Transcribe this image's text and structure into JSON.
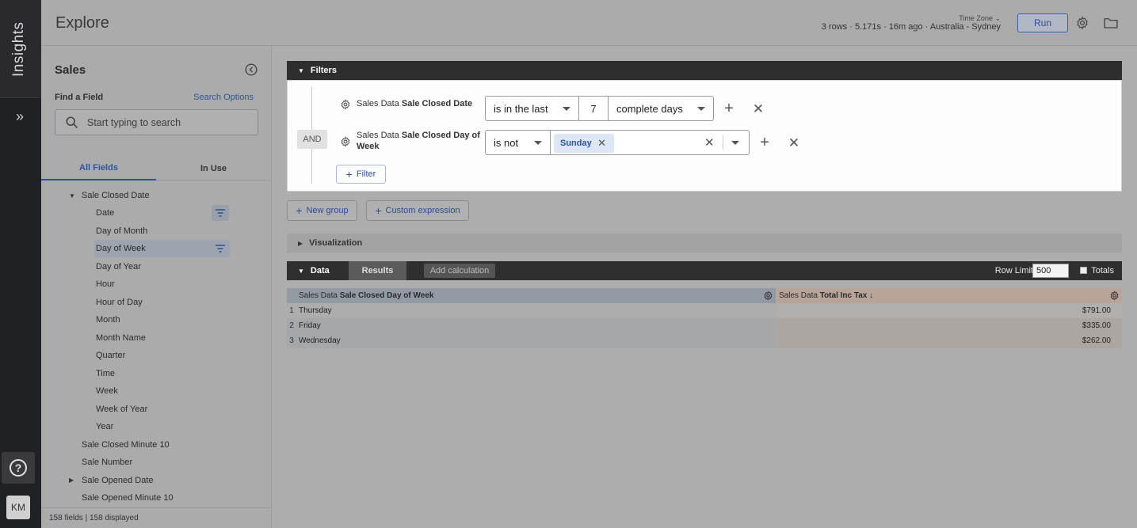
{
  "rail": {
    "brand": "Insights",
    "avatar_initials": "KM"
  },
  "header": {
    "title": "Explore",
    "timezone_label": "Time Zone",
    "run_meta": "3 rows · 5.171s · 16m ago · Australia - Sydney",
    "run_label": "Run"
  },
  "field_panel": {
    "explore_name": "Sales",
    "find_label": "Find a Field",
    "search_options": "Search Options",
    "search_placeholder": "Start typing to search",
    "tabs": [
      "All Fields",
      "In Use"
    ],
    "group": "Sale Closed Date",
    "timeframes": [
      "Date",
      "Day of Month",
      "Day of Week",
      "Day of Year",
      "Hour",
      "Hour of Day",
      "Month",
      "Month Name",
      "Quarter",
      "Time",
      "Week",
      "Week of Year",
      "Year"
    ],
    "more_fields": [
      "Sale Closed Minute 10",
      "Sale Number",
      "Sale Opened Date",
      "Sale Opened Minute 10"
    ],
    "footer": "158 fields | 158 displayed"
  },
  "filters": {
    "section_title": "Filters",
    "connector": "AND",
    "rows": [
      {
        "view": "Sales Data",
        "field": "Sale Closed Date",
        "operator": "is in the last",
        "number": "7",
        "unit": "complete days"
      },
      {
        "view": "Sales Data",
        "field": "Sale Closed Day of",
        "field_line2": "Week",
        "operator": "is not",
        "chip": "Sunday"
      }
    ],
    "add_filter": "Filter",
    "new_group": "New group",
    "custom_expression": "Custom expression"
  },
  "visualization": {
    "title": "Visualization"
  },
  "data": {
    "title": "Data",
    "results_tab": "Results",
    "add_calculation": "Add calculation",
    "row_limit_label": "Row Limit",
    "row_limit": "500",
    "totals_label": "Totals",
    "columns": [
      {
        "view": "Sales Data",
        "field": "Sale Closed Day of Week"
      },
      {
        "view": "Sales Data",
        "field": "Total Inc Tax",
        "sort": "↓"
      }
    ],
    "rows": [
      {
        "n": "1",
        "day": "Thursday",
        "total": "$791.00"
      },
      {
        "n": "2",
        "day": "Friday",
        "total": "$335.00"
      },
      {
        "n": "3",
        "day": "Wednesday",
        "total": "$262.00"
      }
    ]
  }
}
